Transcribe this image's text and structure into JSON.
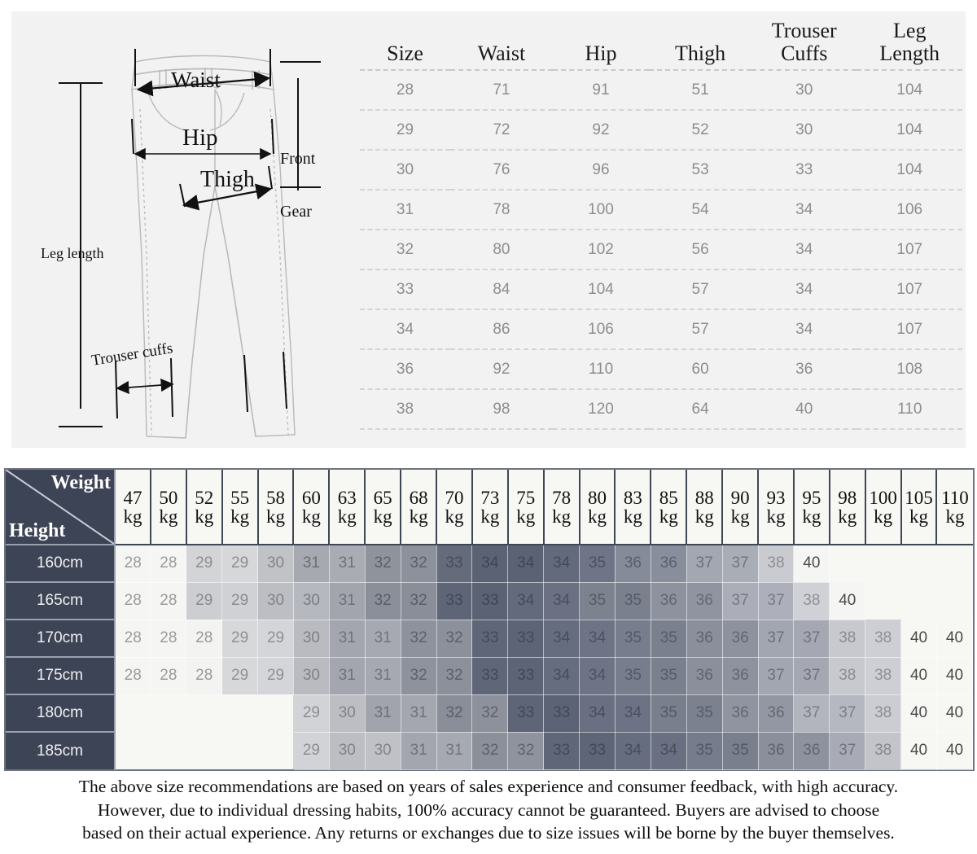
{
  "size_table": {
    "headers": [
      "Size",
      "Waist",
      "Hip",
      "Thigh",
      "Trouser\nCuffs",
      "Leg\nLength"
    ],
    "header_labels": {
      "size": "Size",
      "waist": "Waist",
      "hip": "Hip",
      "thigh": "Thigh",
      "trouser_cuffs_line1": "Trouser",
      "trouser_cuffs_line2": "Cuffs",
      "leg_length_line1": "Leg",
      "leg_length_line2": "Length"
    },
    "rows": [
      [
        "28",
        "71",
        "91",
        "51",
        "30",
        "104"
      ],
      [
        "29",
        "72",
        "92",
        "52",
        "30",
        "104"
      ],
      [
        "30",
        "76",
        "96",
        "53",
        "33",
        "104"
      ],
      [
        "31",
        "78",
        "100",
        "54",
        "34",
        "106"
      ],
      [
        "32",
        "80",
        "102",
        "56",
        "34",
        "107"
      ],
      [
        "33",
        "84",
        "104",
        "57",
        "34",
        "107"
      ],
      [
        "34",
        "86",
        "106",
        "57",
        "34",
        "107"
      ],
      [
        "36",
        "92",
        "110",
        "60",
        "36",
        "108"
      ],
      [
        "38",
        "98",
        "120",
        "64",
        "40",
        "110"
      ]
    ]
  },
  "diagram": {
    "waist_label": "Waist",
    "hip_label": "Hip",
    "thigh_label": "Thigh",
    "front_gear_line1": "Front",
    "front_gear_line2": "Gear",
    "leg_length_label": "Leg length",
    "trouser_cuffs_label": "Trouser cuffs"
  },
  "matrix": {
    "corner": {
      "weight_label": "Weight",
      "height_label": "Height"
    },
    "weight_columns": [
      "47",
      "50",
      "52",
      "55",
      "58",
      "60",
      "63",
      "65",
      "68",
      "70",
      "73",
      "75",
      "78",
      "80",
      "83",
      "85",
      "88",
      "90",
      "93",
      "95",
      "98",
      "100",
      "105",
      "110"
    ],
    "weight_unit": "kg",
    "height_rows": [
      "160cm",
      "165cm",
      "170cm",
      "175cm",
      "180cm",
      "185cm"
    ],
    "values": [
      [
        "28",
        "28",
        "29",
        "29",
        "30",
        "31",
        "31",
        "32",
        "32",
        "33",
        "34",
        "34",
        "34",
        "35",
        "36",
        "36",
        "37",
        "37",
        "38",
        "40",
        "",
        "",
        "",
        ""
      ],
      [
        "28",
        "28",
        "29",
        "29",
        "30",
        "30",
        "31",
        "32",
        "32",
        "33",
        "33",
        "34",
        "34",
        "35",
        "35",
        "36",
        "36",
        "37",
        "37",
        "38",
        "40",
        "",
        "",
        ""
      ],
      [
        "28",
        "28",
        "28",
        "29",
        "29",
        "30",
        "31",
        "31",
        "32",
        "32",
        "33",
        "33",
        "34",
        "34",
        "35",
        "35",
        "36",
        "36",
        "37",
        "37",
        "38",
        "38",
        "40",
        "40"
      ],
      [
        "28",
        "28",
        "28",
        "29",
        "29",
        "30",
        "31",
        "31",
        "32",
        "32",
        "33",
        "33",
        "34",
        "34",
        "35",
        "35",
        "36",
        "36",
        "37",
        "37",
        "38",
        "38",
        "40",
        "40"
      ],
      [
        "",
        "",
        "",
        "",
        "",
        "29",
        "30",
        "31",
        "31",
        "32",
        "32",
        "33",
        "33",
        "34",
        "34",
        "35",
        "35",
        "36",
        "36",
        "37",
        "37",
        "38",
        "40",
        "40"
      ],
      [
        "",
        "",
        "",
        "",
        "",
        "29",
        "30",
        "30",
        "31",
        "31",
        "32",
        "32",
        "33",
        "33",
        "34",
        "34",
        "35",
        "35",
        "36",
        "36",
        "37",
        "38",
        "40",
        "40"
      ]
    ],
    "shades": [
      [
        "#f5f5f3",
        "#f5f5f3",
        "#d3d4d6",
        "#d6d7d9",
        "#c0c2c6",
        "#a6a9b0",
        "#a9acb3",
        "#8f939c",
        "#8d919b",
        "#656b7a",
        "#5b6274",
        "#5b6274",
        "#636a7b",
        "#6f7586",
        "#868b99",
        "#898e9c",
        "#a3a7b1",
        "#a9adb6",
        "#c9cbd1",
        "#f5f5f3",
        "#f7f7f4",
        "#f7f7f4",
        "#f7f7f4",
        "#f7f7f4"
      ],
      [
        "#f5f5f3",
        "#f5f5f3",
        "#cdced1",
        "#d0d1d4",
        "#bcbec3",
        "#b5b8bf",
        "#a2a5ad",
        "#8b8f99",
        "#8a8e98",
        "#5e6576",
        "#5b6274",
        "#636a7b",
        "#6b7182",
        "#7d828f",
        "#7b808e",
        "#8e929f",
        "#9094a1",
        "#abaeb8",
        "#adb0ba",
        "#cfd1d6",
        "#f5f5f3",
        "#f7f7f4",
        "#f7f7f4",
        "#f7f7f4"
      ],
      [
        "#f5f5f3",
        "#f5f5f3",
        "#f3f3f1",
        "#d7d8da",
        "#d4d5d8",
        "#b9bbc0",
        "#a3a6ae",
        "#a6a9b1",
        "#8e929c",
        "#8c909a",
        "#5f6677",
        "#5d6475",
        "#666d7e",
        "#6e7485",
        "#777d8c",
        "#7a808e",
        "#8b8f9c",
        "#8e929f",
        "#a2a6b0",
        "#a5a8b2",
        "#c7c9cf",
        "#cdcfd4",
        "#f7f7f4",
        "#f7f7f4"
      ],
      [
        "#f5f5f3",
        "#f5f5f3",
        "#f3f3f1",
        "#d7d8da",
        "#d4d5d8",
        "#b9bbc0",
        "#a3a6ae",
        "#a6a9b1",
        "#8e929c",
        "#8c909a",
        "#5f6677",
        "#5d6475",
        "#666d7e",
        "#6e7485",
        "#777d8c",
        "#7a808e",
        "#8b8f9c",
        "#8e929f",
        "#a2a6b0",
        "#a5a8b2",
        "#c7c9cf",
        "#cdcfd4",
        "#f7f7f4",
        "#f7f7f4"
      ],
      [
        "#f7f7f4",
        "#f7f7f4",
        "#f7f7f4",
        "#f7f7f4",
        "#f7f7f4",
        "#d2d3d6",
        "#bcbec3",
        "#a1a4ac",
        "#a4a7af",
        "#8a8e98",
        "#8d919b",
        "#5e6576",
        "#5c6374",
        "#6a7081",
        "#6d7384",
        "#797f8d",
        "#7c818f",
        "#9094a0",
        "#9397a3",
        "#b2b5bd",
        "#b5b8c0",
        "#cbcdd2",
        "#f7f7f4",
        "#f7f7f4"
      ],
      [
        "#f7f7f4",
        "#f7f7f4",
        "#f7f7f4",
        "#f7f7f4",
        "#f7f7f4",
        "#d2d3d6",
        "#bcbec3",
        "#bfc1c6",
        "#a3a6ae",
        "#a6a9b1",
        "#8c909a",
        "#8f939d",
        "#5f6677",
        "#5e6576",
        "#666d7e",
        "#6a7081",
        "#767c8b",
        "#797f8d",
        "#8b8f9c",
        "#8e929f",
        "#a8abb5",
        "#c2c4ca",
        "#f7f7f4",
        "#f7f7f4"
      ]
    ],
    "text_colors": [
      [
        "#9b9b9b",
        "#9b9b9b",
        "#8e8e90",
        "#8e8e90",
        "#84858a",
        "#6b6e76",
        "#6e7179",
        "#5c5f68",
        "#5b5e67",
        "#474b58",
        "#3f4554",
        "#3f4554",
        "#454a59",
        "#4b505f",
        "#5a5e6b",
        "#5c606d",
        "#6e7179",
        "#73767f",
        "#8c8e94",
        "#4a4a4a",
        "",
        "",
        "",
        ""
      ],
      [
        "#9b9b9b",
        "#9b9b9b",
        "#8b8b8d",
        "#8b8b8d",
        "#818287",
        "#7b7d84",
        "#6e7179",
        "#5a5d66",
        "#595c65",
        "#424856",
        "#3f4554",
        "#454a59",
        "#4a4f5e",
        "#565a68",
        "#545966",
        "#62666f",
        "#64686f",
        "#75787f",
        "#777a82",
        "#8e9096",
        "#4a4a4a",
        "",
        "",
        ""
      ],
      [
        "#9b9b9b",
        "#9b9b9b",
        "#9a9a99",
        "#91918f",
        "#8f908f",
        "#7e8086",
        "#6f7279",
        "#71747b",
        "#5e616a",
        "#5c5f68",
        "#434957",
        "#424855",
        "#474d5c",
        "#4d5260",
        "#535865",
        "#565b68",
        "#5f636c",
        "#62666f",
        "#6d7078",
        "#6f727a",
        "#8a8c92",
        "#8e9096",
        "#4a4a4a",
        "#4a4a4a"
      ],
      [
        "#9b9b9b",
        "#9b9b9b",
        "#9a9a99",
        "#91918f",
        "#8f908f",
        "#7e8086",
        "#6f7279",
        "#71747b",
        "#5e616a",
        "#5c5f68",
        "#434957",
        "#424855",
        "#474d5c",
        "#4d5260",
        "#535865",
        "#565b68",
        "#5f636c",
        "#62666f",
        "#6d7078",
        "#6f727a",
        "#8a8c92",
        "#8e9096",
        "#4a4a4a",
        "#4a4a4a"
      ],
      [
        "",
        "",
        "",
        "",
        "",
        "8d8e92",
        "#818287",
        "#6d7078",
        "#6f727a",
        "#5c5f68",
        "#5e616a",
        "#424856",
        "#414755",
        "#484d5c",
        "#4a4f5e",
        "#545966",
        "#565b68",
        "#62666f",
        "#64686f",
        "#797c84",
        "#7b7e86",
        "#8b8d93",
        "#4a4a4a",
        "#4a4a4a"
      ],
      [
        "",
        "",
        "",
        "",
        "",
        "#8d8e92",
        "#818287",
        "#838489",
        "#6f727a",
        "#71747b",
        "#5e616a",
        "#60636c",
        "#434957",
        "#424856",
        "#474d5c",
        "#484d5c",
        "#525764",
        "#545966",
        "#5f636c",
        "#62666f",
        "#717480",
        "#85878e",
        "#4a4a4a",
        "#4a4a4a"
      ]
    ]
  },
  "disclaimer": {
    "line1": "The above size recommendations are based on years of sales experience and consumer feedback, with high accuracy.",
    "line2": "However, due to individual dressing habits, 100% accuracy cannot be guaranteed. Buyers are advised to choose",
    "line3": "based on their actual experience. Any returns or exchanges due to size issues will be borne by the buyer themselves."
  },
  "colors": {
    "panel_bg": "#f2f2f2",
    "header_dark": "#3d4455",
    "grid_line": "#9aa0ac",
    "cell_empty": "#f7f7f4"
  }
}
